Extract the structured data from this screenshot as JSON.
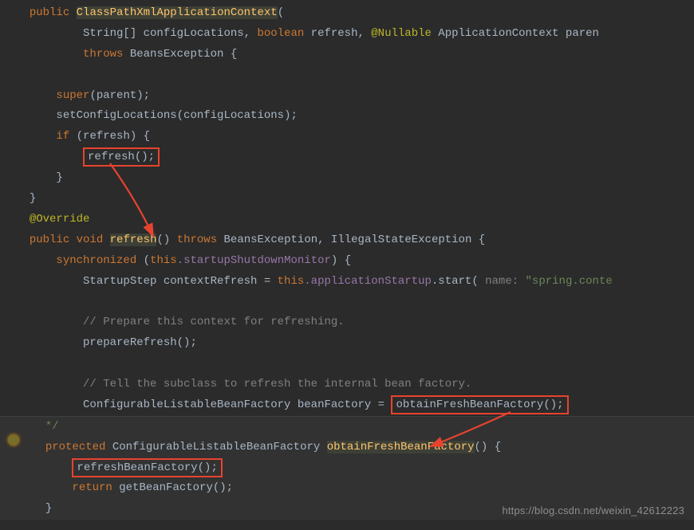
{
  "section1": {
    "l1_kw": "public",
    "l1_method": "ClassPathXmlApplicationContext",
    "l1_paren_open": "(",
    "l2_p1": "String[] configLocations, ",
    "l2_kw": "boolean",
    "l2_p2": " refresh, ",
    "l2_anno": "@Nullable",
    "l2_p3": " ApplicationContext paren",
    "l3_kw": "throws",
    "l3_ex": " BeansException {",
    "l5_kw": "super",
    "l5_rest": "(parent);",
    "l6": "setConfigLocations(configLocations);",
    "l7_kw": "if",
    "l7_rest": " (refresh) {",
    "l8_call": "refresh();",
    "l9": "}",
    "l10": "}"
  },
  "section2": {
    "anno": "@Override",
    "l12_kw1": "public",
    "l12_kw2": "void",
    "l12_method": "refresh",
    "l12_rest1": "() ",
    "l12_kw3": "throws",
    "l12_rest2": " BeansException, IllegalStateException {",
    "l13_kw": "synchronized",
    "l13_paren": " (",
    "l13_this": "this",
    "l13_field": ".startupShutdownMonitor",
    "l13_close": ") {",
    "l14_p1": "StartupStep contextRefresh = ",
    "l14_this": "this",
    "l14_field": ".applicationStartup",
    "l14_p2": ".start(",
    "l14_hint": " name: ",
    "l14_str": "\"spring.conte",
    "l16_c": "// Prepare this context for refreshing.",
    "l17": "prepareRefresh();",
    "l19_c": "// Tell the subclass to refresh the internal bean factory.",
    "l20_p1": "ConfigurableListableBeanFactory beanFactory = ",
    "l20_call": "obtainFreshBeanFactory();"
  },
  "section3": {
    "l22_kw": "protected",
    "l22_type": " ConfigurableListableBeanFactory ",
    "l22_method": "obtainFreshBeanFactory",
    "l22_rest": "() {",
    "l23_call": "refreshBeanFactory();",
    "l24_kw": "return",
    "l24_rest": " getBeanFactory();",
    "l25": "}"
  },
  "watermark": "https://blog.csdn.net/weixin_42612223"
}
